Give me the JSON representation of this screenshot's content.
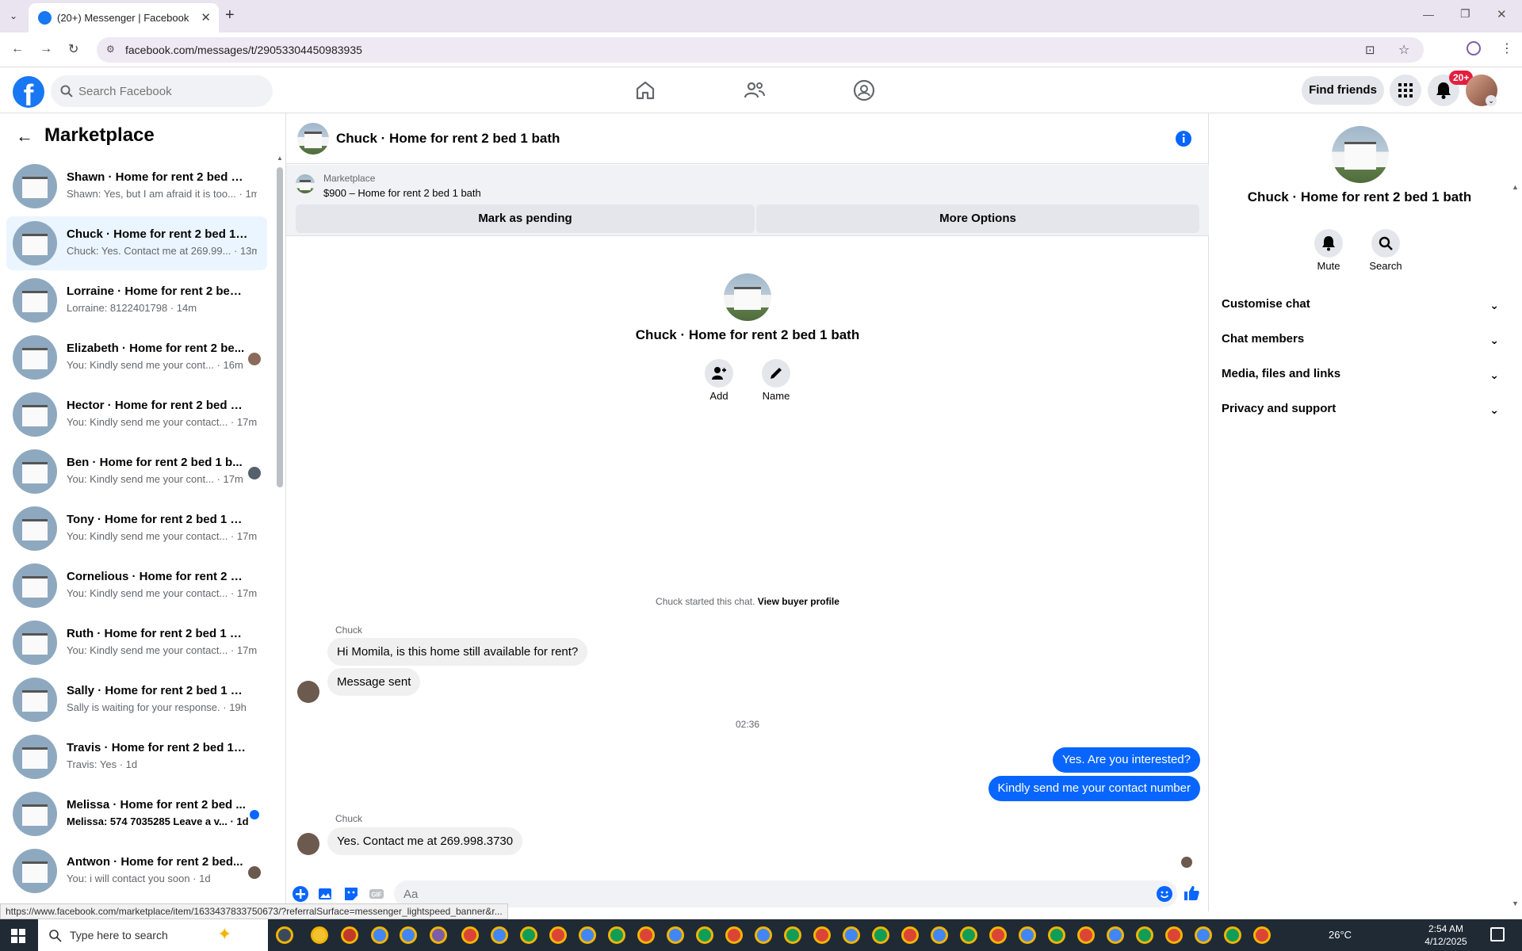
{
  "browser": {
    "tab_title": "(20+) Messenger | Facebook",
    "url": "facebook.com/messages/t/29053304450983935",
    "status_url": "https://www.facebook.com/marketplace/item/1633437833750673/?referralSurface=messenger_lightspeed_banner&r..."
  },
  "fb": {
    "logo": "f",
    "search_placeholder": "Search Facebook",
    "find_friends": "Find friends",
    "notif_badge": "20+"
  },
  "left": {
    "title": "Marketplace",
    "conversations": [
      {
        "name": "Shawn · Home for rent 2 bed 1 b...",
        "sub": "Shawn: Yes, but I am afraid it is too... · 1m",
        "unread": false
      },
      {
        "name": "Chuck · Home for rent 2 bed 1 b...",
        "sub": "Chuck: Yes. Contact me at 269.99... · 13m",
        "unread": false
      },
      {
        "name": "Lorraine · Home for rent 2 bed 1...",
        "sub": "Lorraine: 8122401798 · 14m",
        "unread": false
      },
      {
        "name": "Elizabeth · Home for rent 2 be...",
        "sub": "You: Kindly send me your cont... · 16m",
        "unread": false
      },
      {
        "name": "Hector · Home for rent 2 bed 1 b...",
        "sub": "You: Kindly send me your contact... · 17m",
        "unread": false
      },
      {
        "name": "Ben · Home for rent 2 bed 1 b...",
        "sub": "You: Kindly send me your cont... · 17m",
        "unread": false
      },
      {
        "name": "Tony · Home for rent 2 bed 1 bath",
        "sub": "You: Kindly send me your contact... · 17m",
        "unread": false
      },
      {
        "name": "Cornelious · Home for rent 2 be...",
        "sub": "You: Kindly send me your contact... · 17m",
        "unread": false
      },
      {
        "name": "Ruth · Home for rent 2 bed 1 bath",
        "sub": "You: Kindly send me your contact... · 17m",
        "unread": false
      },
      {
        "name": "Sally · Home for rent 2 bed 1 bath",
        "sub": "Sally is waiting for your response. · 19h",
        "unread": false
      },
      {
        "name": "Travis · Home for rent 2 bed 1 ba...",
        "sub": "Travis: Yes · 1d",
        "unread": false
      },
      {
        "name": "Melissa · Home for rent 2 bed ...",
        "sub": "Melissa: 574 7035285 Leave a v... · 1d",
        "unread": true
      },
      {
        "name": "Antwon · Home for rent 2 bed...",
        "sub": "You: i will contact you soon · 1d",
        "unread": false
      }
    ]
  },
  "chat": {
    "title": "Chuck · Home for rent 2 bed 1 bath",
    "banner_label": "Marketplace",
    "banner_listing": "$900 – Home for rent 2 bed 1 bath",
    "mark_pending": "Mark as pending",
    "more_options": "More Options",
    "intro_name": "Chuck · Home for rent 2 bed 1 bath",
    "add_label": "Add",
    "name_label": "Name",
    "started_text": "Chuck started this chat.",
    "view_profile": "View buyer profile",
    "sender1": "Chuck",
    "msg1": "Hi Momila, is this home still available for rent?",
    "msg2": "Message sent",
    "timestamp": "02:36",
    "out1": "Yes. Are you interested?",
    "out2": "Kindly send me your contact number",
    "sender2": "Chuck",
    "msg3": "Yes. Contact me at 269.998.3730",
    "composer_placeholder": "Aa"
  },
  "info": {
    "name": "Chuck · Home for rent 2 bed 1 bath",
    "mute": "Mute",
    "search": "Search",
    "sections": [
      "Customise chat",
      "Chat members",
      "Media, files and links",
      "Privacy and support"
    ]
  },
  "taskbar": {
    "search_placeholder": "Type here to search",
    "temperature": "26°C",
    "time": "2:54 AM",
    "date": "4/12/2025"
  },
  "colors": {
    "fb_blue": "#0866ff",
    "selected_bg": "#ebf5ff"
  }
}
